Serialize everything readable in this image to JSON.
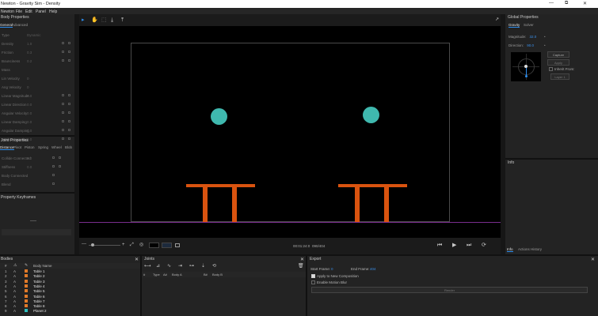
{
  "window": {
    "title": "Newton - Gravity Sim - Density",
    "controls": [
      "—",
      "⧉",
      "✕"
    ]
  },
  "menu": [
    "Newton",
    "File",
    "Edit",
    "Panel",
    "Help"
  ],
  "body_properties": {
    "header": "Body Properties",
    "tabs": [
      "General",
      "Advanced"
    ],
    "rows": [
      {
        "label": "Type",
        "value": "Dynamic"
      },
      {
        "label": "Density",
        "value": "1.0"
      },
      {
        "label": "Friction",
        "value": "0.3"
      },
      {
        "label": "Bounciness",
        "value": "0.2"
      },
      {
        "label": "Mass",
        "value": ""
      },
      {
        "label": "Lin Velocity",
        "value": "0"
      },
      {
        "label": "Ang Velocity",
        "value": "0"
      },
      {
        "label": "Linear Magnitude",
        "value": "0.0"
      },
      {
        "label": "Linear Direction",
        "value": "0.0"
      },
      {
        "label": "Angular Velocity",
        "value": "0.0"
      },
      {
        "label": "Linear Damping",
        "value": "0.0"
      },
      {
        "label": "Angular Damping",
        "value": "0.0"
      },
      {
        "label": "Motion Damping",
        "value": "0.0"
      }
    ]
  },
  "joint_properties": {
    "header": "Joint Properties",
    "tabs": [
      "Distance",
      "Pivot",
      "Piston",
      "Spring",
      "Wheel",
      "Blob"
    ],
    "rows": [
      {
        "label": "Collide Connected",
        "value": "0.0"
      },
      {
        "label": "Stiffness",
        "value": "0.0"
      },
      {
        "label": "Body Connected",
        "value": ""
      },
      {
        "label": "Blend",
        "value": ""
      }
    ]
  },
  "keyframes": {
    "header": "Property Keyframes"
  },
  "toolbar": {
    "select": "▸",
    "hand": "✋",
    "grid": "⬚",
    "pin": "⤓",
    "arrow": "⤒",
    "graph": "↗"
  },
  "playback": {
    "time": "00:01:24:0",
    "frame": "090/404",
    "zoom_label": "—"
  },
  "global_properties": {
    "header": "Global Properties",
    "tabs": [
      "Gravity",
      "Solver"
    ],
    "magnitude_label": "Magnitude:",
    "magnitude_value": "32.0",
    "direction_label": "Direction:",
    "direction_value": "90.0",
    "capture_label": "Capture",
    "apply_label": "Apply",
    "inherit_label": "Inherit From:",
    "inherit_value": "Layer 1"
  },
  "info": {
    "header": "Info",
    "tabs": [
      "Info",
      "Actions History"
    ]
  },
  "bodies": {
    "header": "Bodies",
    "columns": [
      "#",
      "",
      "",
      "Body Name"
    ],
    "rows": [
      {
        "num": "1",
        "type": "A",
        "color": "#e07a2a",
        "name": "Table 1"
      },
      {
        "num": "2",
        "type": "A",
        "color": "#e07a2a",
        "name": "Table 2"
      },
      {
        "num": "3",
        "type": "A",
        "color": "#e07a2a",
        "name": "Table 3"
      },
      {
        "num": "4",
        "type": "A",
        "color": "#e07a2a",
        "name": "Table 4"
      },
      {
        "num": "5",
        "type": "A",
        "color": "#e07a2a",
        "name": "Table 5"
      },
      {
        "num": "6",
        "type": "A",
        "color": "#e07a2a",
        "name": "Table 6"
      },
      {
        "num": "7",
        "type": "A",
        "color": "#e07a2a",
        "name": "Table 7"
      },
      {
        "num": "8",
        "type": "A",
        "color": "#e07a2a",
        "name": "Table 8"
      },
      {
        "num": "9",
        "type": "A",
        "color": "#2dbfbf",
        "name": "Planet 2"
      }
    ]
  },
  "joints": {
    "header": "Joints",
    "columns": [
      "#",
      "Type",
      "A#",
      "Body A",
      "B#",
      "Body B"
    ]
  },
  "export": {
    "header": "Export",
    "start_label": "Start Frame:",
    "start_value": "0",
    "end_label": "End Frame:",
    "end_value": "404",
    "apply_label": "Apply to New Composition",
    "motion_blur_label": "Enable Motion Blur",
    "render_label": "Render"
  },
  "colors": {
    "accent": "#2d8ceb",
    "ball": "#3fb8ae",
    "table": "#d9530f",
    "ground": "#7a2d8f"
  }
}
